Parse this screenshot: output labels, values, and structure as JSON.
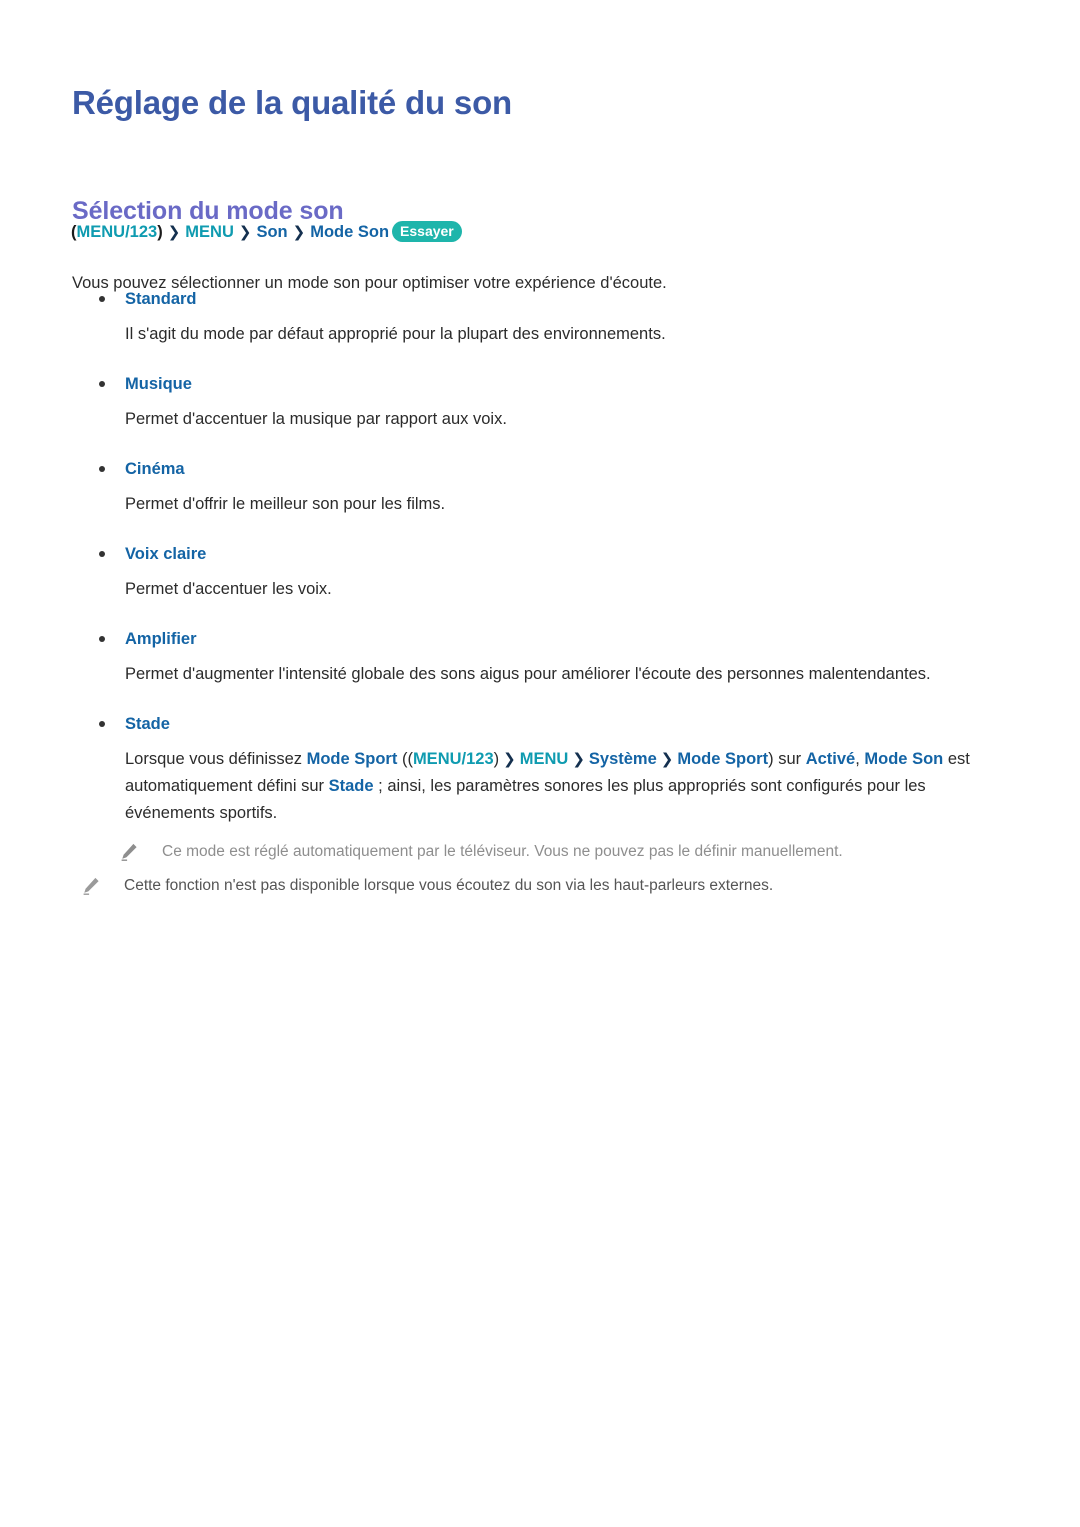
{
  "document": {
    "title": "Réglage de la qualité du son",
    "section_title": "Sélection du mode son",
    "intro": "Vous pouvez sélectionner un mode son pour optimiser votre expérience d'écoute."
  },
  "colors": {
    "title_blue": "#3c5aa6",
    "section_violet": "#6a6ac6",
    "link_blue": "#1464a5",
    "menu_teal": "#0f9bb0",
    "badge_teal": "#1eb5ab",
    "body_text": "#2b2b2b",
    "note_gray": "#8e8e8e"
  },
  "breadcrumb": {
    "open_paren": "(",
    "menu_key": "MENU/123",
    "close_paren": ")",
    "separator": "❯",
    "step_menu": "MENU",
    "step_son": "Son",
    "step_mode_son": "Mode Son",
    "badge": "Essayer"
  },
  "bullets": [
    {
      "label": "Standard",
      "description": "Il s'agit du mode par défaut approprié pour la plupart des environnements."
    },
    {
      "label": "Musique",
      "description": "Permet d'accentuer la musique par rapport aux voix."
    },
    {
      "label": "Cinéma",
      "description": "Permet d'offrir le meilleur son pour les films."
    },
    {
      "label": "Voix claire",
      "description": "Permet d'accentuer les voix."
    },
    {
      "label": "Amplifier",
      "description": "Permet d'augmenter l'intensité globale des sons aigus pour améliorer l'écoute des personnes malentendantes."
    },
    {
      "label": "Stade",
      "description_parts": {
        "t1": "Lorsque vous définissez ",
        "b1": "Mode Sport",
        "t2": " ((",
        "m1": "MENU/123",
        "t3": ")",
        "sep": "❯",
        "m2": "MENU",
        "b2": "Système",
        "b3": "Mode Sport",
        "t4": ") sur ",
        "b4": "Activé",
        "t5": ", ",
        "b5": "Mode Son",
        "t6": " est automatiquement défini sur ",
        "b6": "Stade",
        "t7": " ; ainsi, les paramètres sonores les plus appropriés sont configurés pour les événements sportifs."
      }
    }
  ],
  "notes": [
    {
      "icon": "pencil-icon",
      "text": "Ce mode est réglé automatiquement par le téléviseur. Vous ne pouvez pas le définir manuellement."
    },
    {
      "icon": "pencil-icon",
      "text": "Cette fonction n'est pas disponible lorsque vous écoutez du son via les haut-parleurs externes."
    }
  ]
}
